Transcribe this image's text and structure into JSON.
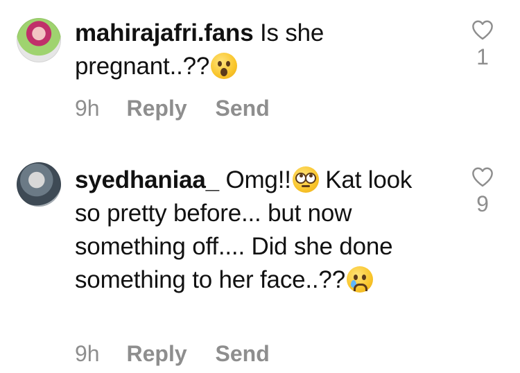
{
  "comments": [
    {
      "username": "mahirajafri.fans",
      "text": "Is she pregnant..??",
      "emoji": "hushed-face",
      "time": "9h",
      "reply_label": "Reply",
      "send_label": "Send",
      "likes": "1"
    },
    {
      "username": "syedhaniaa_",
      "text_part1": "Omg!!",
      "emoji1": "face-with-rolling-eyes",
      "text_part2": "Kat look so pretty before... but now something off.... Did she done something to her face..??",
      "emoji2": "crying-face",
      "time": "9h",
      "reply_label": "Reply",
      "send_label": "Send",
      "likes": "9"
    }
  ]
}
